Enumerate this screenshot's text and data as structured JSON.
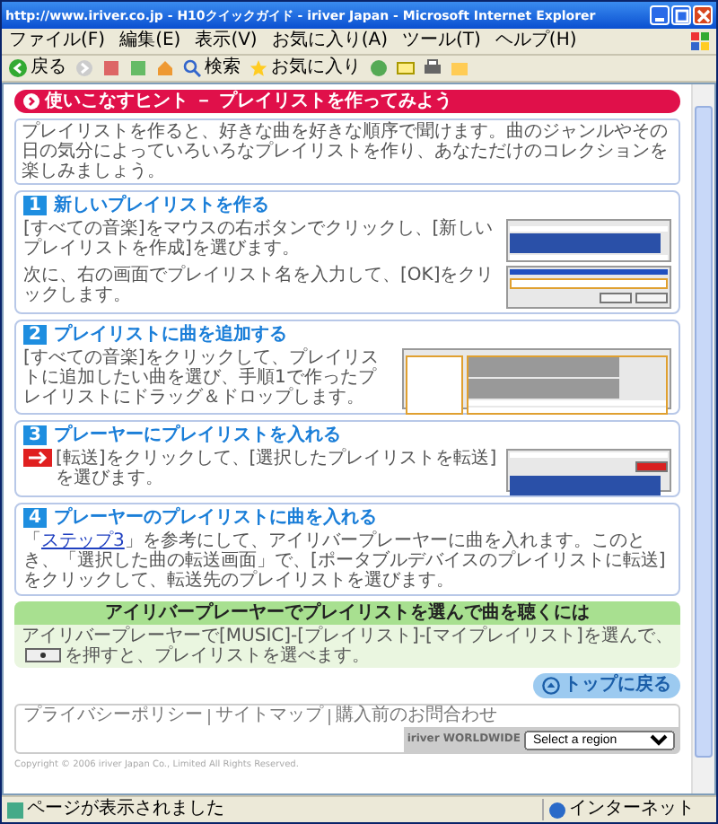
{
  "window": {
    "title": "http://www.iriver.co.jp - H10クイックガイド - iriver Japan - Microsoft Internet Explorer"
  },
  "menu": [
    "ファイル(F)",
    "編集(E)",
    "表示(V)",
    "お気に入り(A)",
    "ツール(T)",
    "ヘルプ(H)"
  ],
  "toolbar": {
    "back": "戻る",
    "search": "検索",
    "favorites": "お気に入り"
  },
  "page": {
    "header": "使いこなすヒント － プレイリストを作ってみよう",
    "intro": "プレイリストを作ると、好きな曲を好きな順序で聞けます。曲のジャンルやその日の気分によっていろいろなプレイリストを作り、あなただけのコレクションを楽しみましょう。",
    "steps": [
      {
        "number": "1",
        "title": "新しいプレイリストを作る",
        "transfer_icon": false,
        "paragraphs": [
          {
            "kind": "context-menu",
            "segments": [
              {
                "text": "[すべての音楽]をマウスの右ボタンでクリックし、[新しいプレイリストを作成]を選びます。",
                "link": false
              }
            ]
          },
          {
            "kind": "name-dialog",
            "segments": [
              {
                "text": "次に、右の画面でプレイリスト名を入力して、[OK]をクリックします。",
                "link": false
              }
            ]
          }
        ]
      },
      {
        "number": "2",
        "title": "プレイリストに曲を追加する",
        "transfer_icon": false,
        "paragraphs": [
          {
            "kind": "library",
            "segments": [
              {
                "text": "[すべての音楽]をクリックして、プレイリストに追加したい曲を選び、手順1で作ったプレイリストにドラッグ＆ドロップします。",
                "link": false
              }
            ]
          }
        ]
      },
      {
        "number": "3",
        "title": "プレーヤーにプレイリストを入れる",
        "transfer_icon": true,
        "paragraphs": [
          {
            "kind": "transfer-menu",
            "segments": [
              {
                "text": "[転送]をクリックして、[選択したプレイリストを転送]を選びます。",
                "link": false
              }
            ]
          }
        ]
      },
      {
        "number": "4",
        "title": "プレーヤーのプレイリストに曲を入れる",
        "transfer_icon": false,
        "paragraphs": [
          {
            "kind": "text",
            "segments": [
              {
                "text": "「",
                "link": false
              },
              {
                "text": "ステップ3",
                "link": true
              },
              {
                "text": "」を参考にして、アイリバープレーヤーに曲を入れます。このとき、「選択した曲の転送画面」で、[ポータブルデバイスのプレイリストに転送]をクリックして、転送先のプレイリストを選びます。",
                "link": false
              }
            ]
          }
        ]
      }
    ],
    "tip": {
      "title": "アイリバープレーヤーでプレイリストを選んで曲を聴くには",
      "text_before": "アイリバープレーヤーで[MUSIC]-[プレイリスト]-[マイプレイリスト]を選んで、",
      "text_after": "を押すと、プレイリストを選べます。"
    },
    "top_link": "トップに戻る",
    "footer": {
      "links": [
        "プライバシーポリシー",
        "サイトマップ",
        "購入前のお問合わせ"
      ],
      "worldwide": "iriver WORLDWIDE",
      "region_select": {
        "placeholder": "Select a region"
      },
      "copyright": "Copyright © 2006 iriver Japan Co., Limited All Rights Reserved."
    }
  },
  "status_bar": {
    "text": "ページが表示されました",
    "zone": "インターネット"
  }
}
